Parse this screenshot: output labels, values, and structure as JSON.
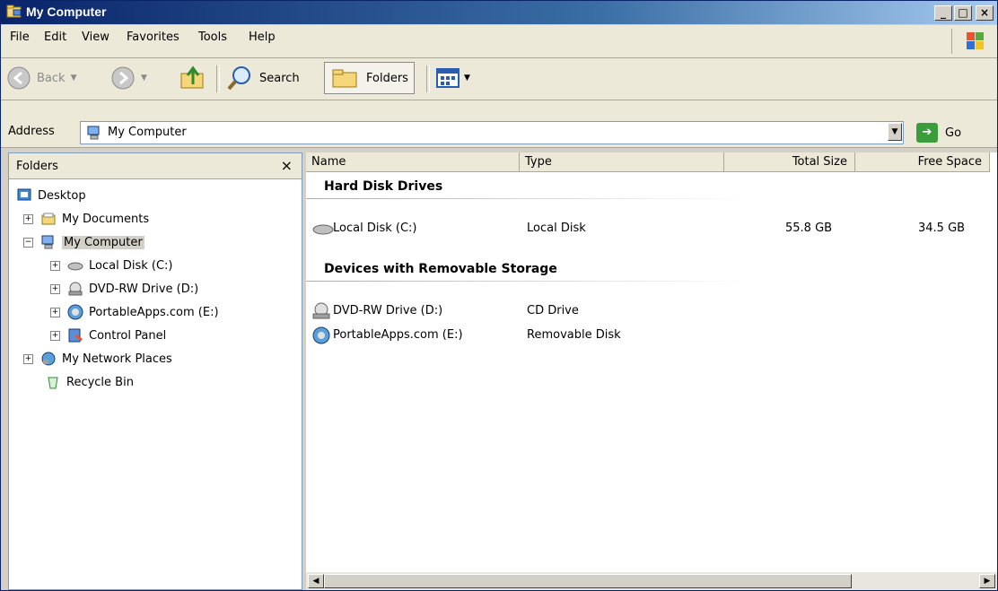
{
  "window": {
    "title": "My Computer",
    "min_label": "_",
    "max_label": "□",
    "close_label": "×"
  },
  "menu": {
    "items": [
      "File",
      "Edit",
      "View",
      "Favorites",
      "Tools",
      "Help"
    ]
  },
  "toolbar": {
    "back_label": "Back",
    "search_label": "Search",
    "folders_label": "Folders"
  },
  "address": {
    "label": "Address",
    "value": "My Computer",
    "go_label": "Go"
  },
  "folders": {
    "title": "Folders",
    "close": "×",
    "tree": [
      {
        "label": "Desktop",
        "icon": "desktop-icon"
      },
      {
        "label": "My Documents",
        "icon": "folder-icon"
      },
      {
        "label": "My Computer",
        "icon": "computer-icon",
        "selected": true
      },
      {
        "label": "Local Disk (C:)",
        "icon": "drive-icon"
      },
      {
        "label": "DVD-RW Drive (D:)",
        "icon": "dvd-icon"
      },
      {
        "label": "PortableApps.com (E:)",
        "icon": "portable-icon"
      },
      {
        "label": "Control Panel",
        "icon": "control-panel-icon"
      },
      {
        "label": "My Network Places",
        "icon": "network-icon"
      },
      {
        "label": "Recycle Bin",
        "icon": "recycle-bin-icon"
      }
    ]
  },
  "columns": {
    "name": "Name",
    "type": "Type",
    "total_size": "Total Size",
    "free_space": "Free Space"
  },
  "groups": {
    "hard_disks": {
      "title": "Hard Disk Drives",
      "items": [
        {
          "name": "Local Disk (C:)",
          "type": "Local Disk",
          "total": "55.8 GB",
          "free": "34.5 GB"
        }
      ]
    },
    "removable": {
      "title": "Devices with Removable Storage",
      "items": [
        {
          "name": "DVD-RW Drive (D:)",
          "type": "CD Drive"
        },
        {
          "name": "PortableApps.com (E:)",
          "type": "Removable Disk"
        }
      ]
    }
  }
}
